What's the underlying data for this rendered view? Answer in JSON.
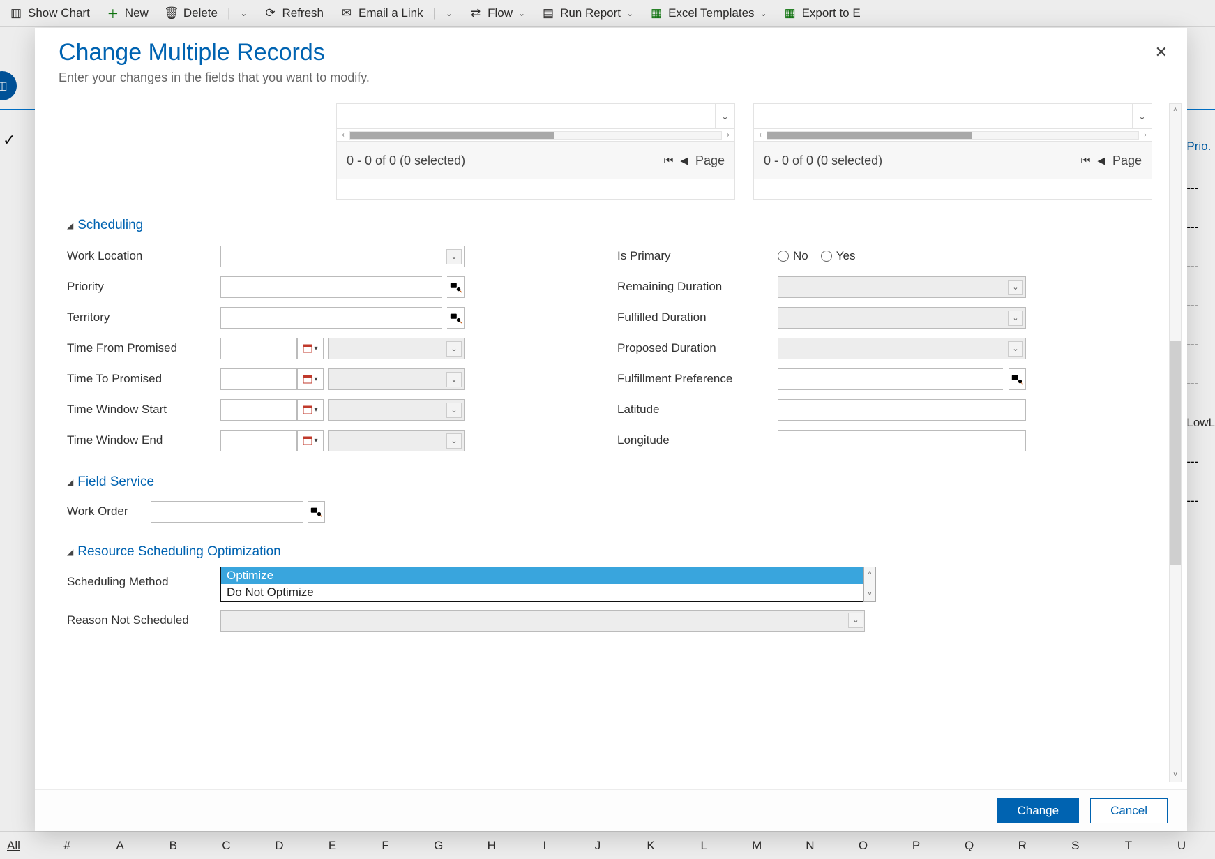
{
  "toolbar": {
    "show_chart": "Show Chart",
    "new": "New",
    "delete": "Delete",
    "refresh": "Refresh",
    "email_link": "Email a Link",
    "flow": "Flow",
    "run_report": "Run Report",
    "excel_templates": "Excel Templates",
    "export_excel": "Export to E"
  },
  "background": {
    "right_col_header": "Prio.",
    "right_cell_sample": "---",
    "right_partial_text": "LowL",
    "alpha_bar": {
      "all": "All",
      "letters": [
        "#",
        "A",
        "B",
        "C",
        "D",
        "E",
        "F",
        "G",
        "H",
        "I",
        "J",
        "K",
        "L",
        "M",
        "N",
        "O",
        "P",
        "Q",
        "R",
        "S",
        "T",
        "U"
      ]
    }
  },
  "modal": {
    "title": "Change Multiple Records",
    "subtitle": "Enter your changes in the fields that you want to modify.",
    "close": "✕",
    "subgrid": {
      "status": "0 - 0 of 0 (0 selected)",
      "page_label": "Page"
    },
    "sections": {
      "scheduling": "Scheduling",
      "field_service": "Field Service",
      "rso": "Resource Scheduling Optimization"
    },
    "labels": {
      "work_location": "Work Location",
      "priority": "Priority",
      "territory": "Territory",
      "time_from_promised": "Time From Promised",
      "time_to_promised": "Time To Promised",
      "time_window_start": "Time Window Start",
      "time_window_end": "Time Window End",
      "is_primary": "Is Primary",
      "is_primary_no": "No",
      "is_primary_yes": "Yes",
      "remaining_duration": "Remaining Duration",
      "fulfilled_duration": "Fulfilled Duration",
      "proposed_duration": "Proposed Duration",
      "fulfillment_pref": "Fulfillment Preference",
      "latitude": "Latitude",
      "longitude": "Longitude",
      "work_order": "Work Order",
      "scheduling_method": "Scheduling Method",
      "reason_not_scheduled": "Reason Not Scheduled"
    },
    "scheduling_method_options": {
      "optimize": "Optimize",
      "do_not_optimize": "Do Not Optimize"
    },
    "buttons": {
      "change": "Change",
      "cancel": "Cancel"
    }
  }
}
